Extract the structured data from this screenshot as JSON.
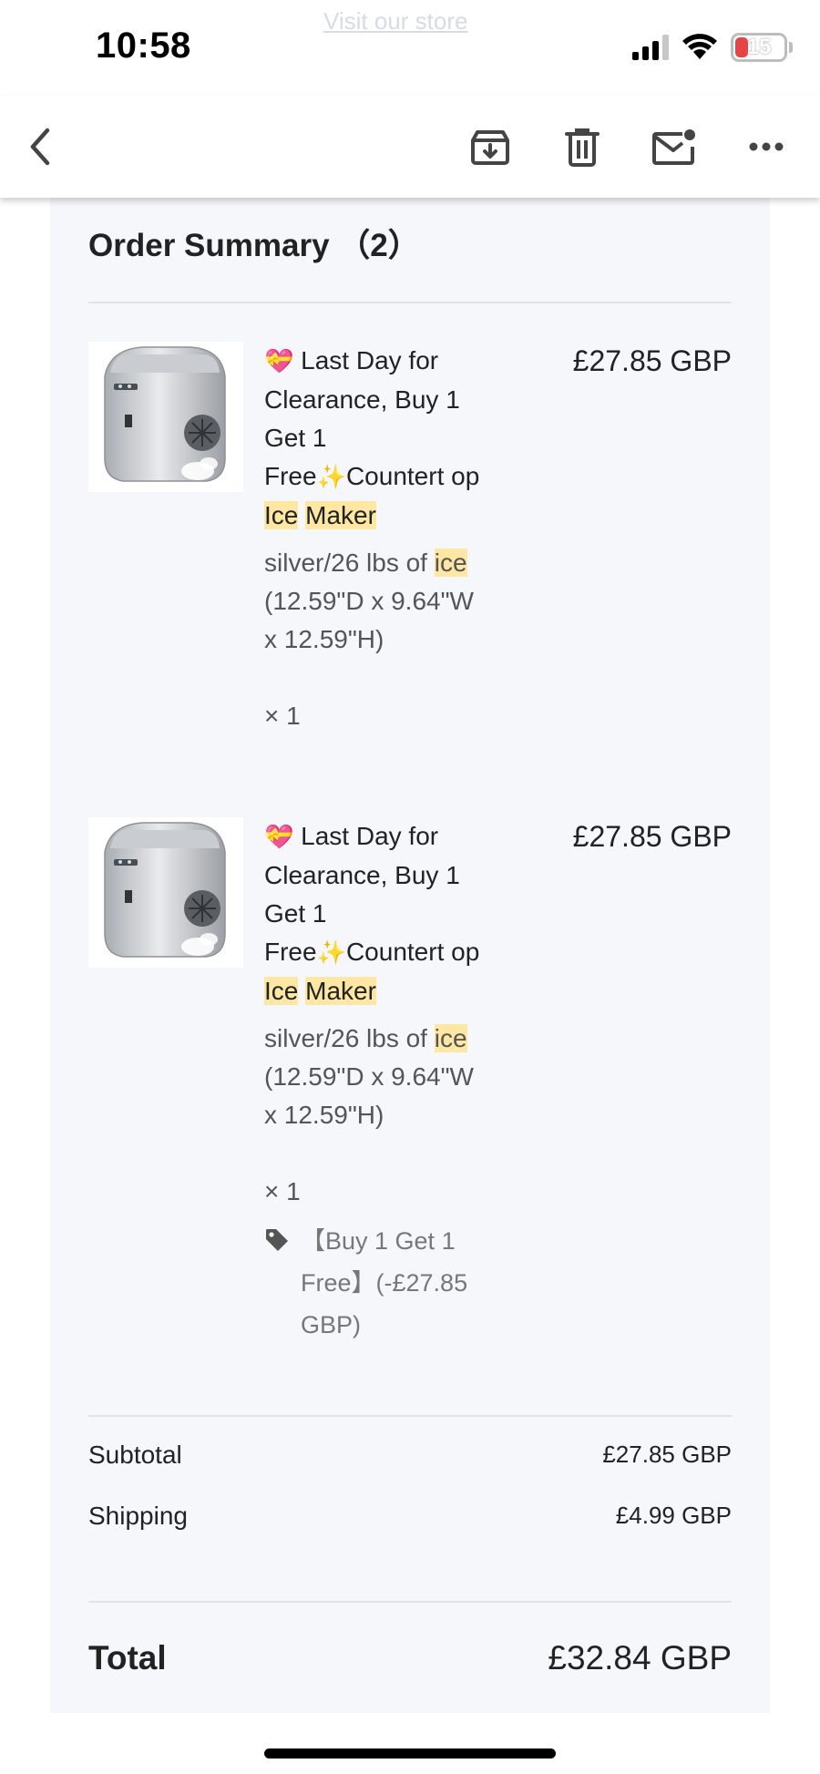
{
  "status_bar": {
    "time": "10:58",
    "battery": "15",
    "ghost_link": "Visit our store"
  },
  "toolbar": {
    "icons": [
      "back-icon",
      "archive-icon",
      "trash-icon",
      "mark-unread-icon",
      "more-icon"
    ]
  },
  "order": {
    "title": "Order Summary （2）",
    "items": [
      {
        "title_prefix": "Last Day for Clearance, Buy 1 Get 1 Free",
        "title_mid": "Countert op ",
        "hl1": "Ice",
        "hl2": "Maker",
        "variant_prefix": "silver/26 lbs of ",
        "variant_hl": "ice",
        "variant_suffix": " (12.59\"D x 9.64\"W x 12.59\"H)",
        "qty": "× 1",
        "price": "£27.85 GBP",
        "emoji_heart": "💝",
        "emoji_sparkle": "✨"
      },
      {
        "title_prefix": "Last Day for Clearance, Buy 1 Get 1 Free",
        "title_mid": "Countert op ",
        "hl1": "Ice",
        "hl2": "Maker",
        "variant_prefix": "silver/26 lbs of ",
        "variant_hl": "ice",
        "variant_suffix": " (12.59\"D x 9.64\"W x 12.59\"H)",
        "qty": "× 1",
        "price": "£27.85 GBP",
        "emoji_heart": "💝",
        "emoji_sparkle": "✨",
        "discount": "【Buy 1 Get 1 Free】(-£27.85 GBP)"
      }
    ],
    "subtotal_label": "Subtotal",
    "subtotal_value": "£27.85 GBP",
    "shipping_label": "Shipping",
    "shipping_value": "£4.99 GBP",
    "total_label": "Total",
    "total_value": "£32.84 GBP"
  },
  "colors": {
    "highlight": "#fde7a3",
    "card_bg": "#f6f7fa",
    "battery_low": "#e94444"
  }
}
